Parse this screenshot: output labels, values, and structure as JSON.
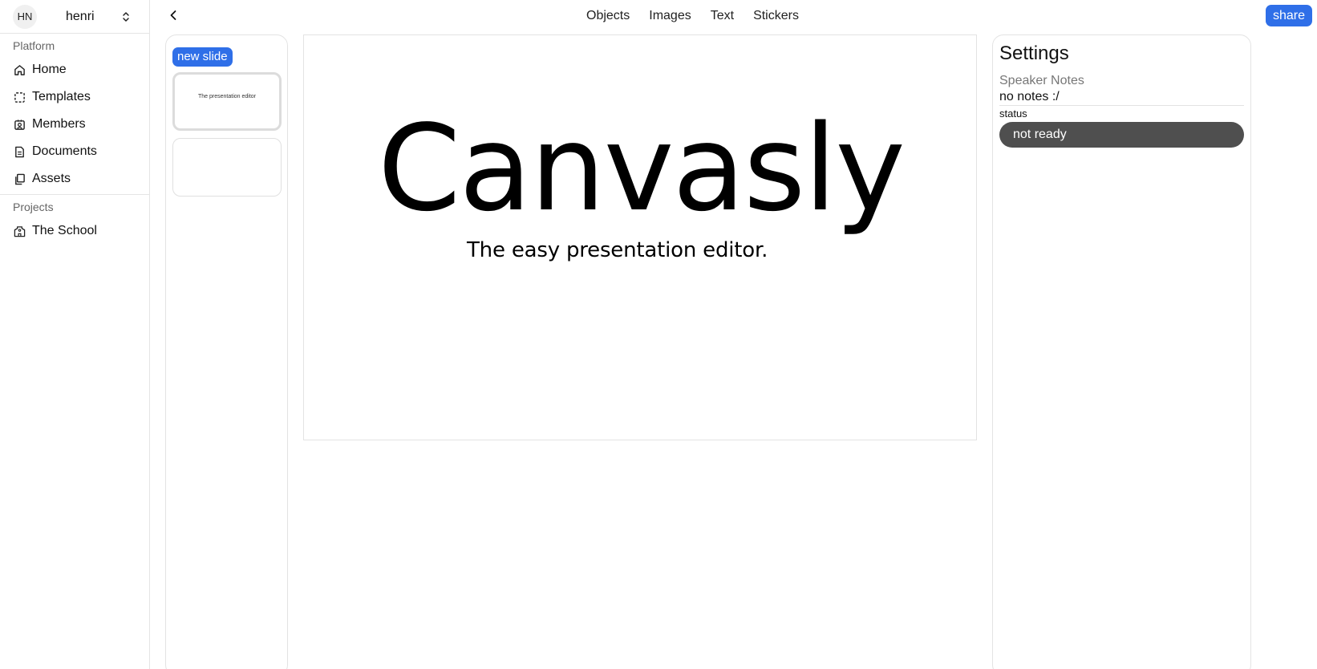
{
  "user": {
    "initials": "HN",
    "name": "henri"
  },
  "sidebar": {
    "platform_label": "Platform",
    "items": [
      {
        "label": "Home",
        "icon": "home-icon"
      },
      {
        "label": "Templates",
        "icon": "templates-icon"
      },
      {
        "label": "Members",
        "icon": "members-icon"
      },
      {
        "label": "Documents",
        "icon": "documents-icon"
      },
      {
        "label": "Assets",
        "icon": "assets-icon"
      }
    ],
    "projects_label": "Projects",
    "projects": [
      {
        "label": "The School",
        "icon": "school-icon"
      }
    ]
  },
  "toolbar": {
    "tabs": [
      "Objects",
      "Images",
      "Text",
      "Stickers"
    ],
    "share_label": "share"
  },
  "slides": {
    "new_slide_label": "new slide",
    "thumbnails": [
      {
        "text": "The presentation editor"
      },
      {
        "text": ""
      }
    ]
  },
  "canvas": {
    "title": "Canvasly",
    "subtitle": "The easy presentation editor."
  },
  "settings": {
    "title": "Settings",
    "notes_label": "Speaker Notes",
    "notes_value": "no notes :/",
    "status_label": "status",
    "status_value": "not ready"
  },
  "colors": {
    "accent": "#2f6fe8",
    "status_bg": "#4f4f4f"
  }
}
